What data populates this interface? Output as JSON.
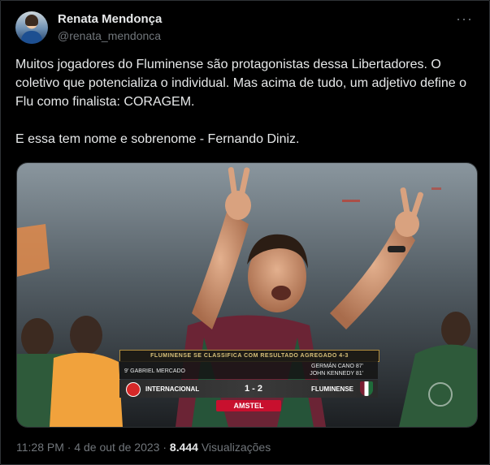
{
  "author": {
    "name": "Renata Mendonça",
    "handle": "@renata_mendonca"
  },
  "menu_icon": "more-options-icon",
  "tweet": {
    "paragraph1": "Muitos jogadores do Fluminense são protagonistas dessa Libertadores. O coletivo que potencializa o individual. Mas acima de tudo, um adjetivo define o Flu como finalista: CORAGEM.",
    "paragraph2": "E essa tem nome e sobrenome - Fernando Diniz."
  },
  "scoreboard": {
    "header": "FLUMINENSE SE CLASSIFICA COM RESULTADO AGREGADO 4-3",
    "home_scorer": "9' GABRIEL MERCADO",
    "away_scorer1": "GERMÁN CANO 87'",
    "away_scorer2": "JOHN KENNEDY 81'",
    "home_team": "INTERNACIONAL",
    "score": "1 - 2",
    "away_team": "FLUMINENSE",
    "sponsor": "AMSTEL"
  },
  "meta": {
    "time": "11:28 PM",
    "sep1": "·",
    "date": "4 de out de 2023",
    "sep2": "·",
    "views_count": "8.444",
    "views_label": "Visualizações"
  }
}
